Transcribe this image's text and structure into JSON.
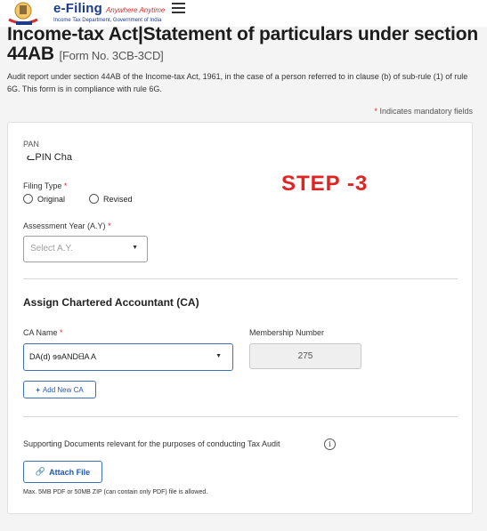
{
  "header": {
    "brand": "e-Filing",
    "tagline": "Anywhere Anytime",
    "dept": "Income Tax Department, Government of India"
  },
  "page": {
    "title": "Income-tax Act|Statement of particulars under section 44AB",
    "form_no": "[Form No. 3CB-3CD]",
    "description": "Audit report under section 44AB of the Income-tax Act, 1961, in the case of a person referred to in clause (b) of sub-rule (1) of rule 6G. This form is in compliance with rule 6G.",
    "mandatory_star": "*",
    "mandatory_note": "Indicates mandatory fields"
  },
  "form": {
    "pan_label": "PAN",
    "pan_value": "ᓚPIN Cha",
    "filing_type_label": "Filing Type",
    "filing_type_options": [
      "Original",
      "Revised"
    ],
    "ay_label": "Assessment Year (A.Y)",
    "ay_placeholder": "Select A.Y.",
    "required_star": "*",
    "ca_section_title": "Assign Chartered Accountant (CA)",
    "ca_name_label": "CA Name",
    "ca_name_value": "DA(d) ɘɘANDᗺA A",
    "membership_label": "Membership Number",
    "membership_value": "275",
    "add_ca_button": "Add New CA",
    "supporting_docs_label": "Supporting Documents relevant for the purposes of conducting Tax Audit",
    "attach_button": "Attach File",
    "file_hint": "Max. 5MB PDF or 50MB ZIP (can contain only PDF) file is allowed."
  },
  "overlay": {
    "step_text": "STEP -3"
  },
  "colors": {
    "accent": "#1f58b3",
    "required": "#d32f2f",
    "step": "#e02424"
  }
}
